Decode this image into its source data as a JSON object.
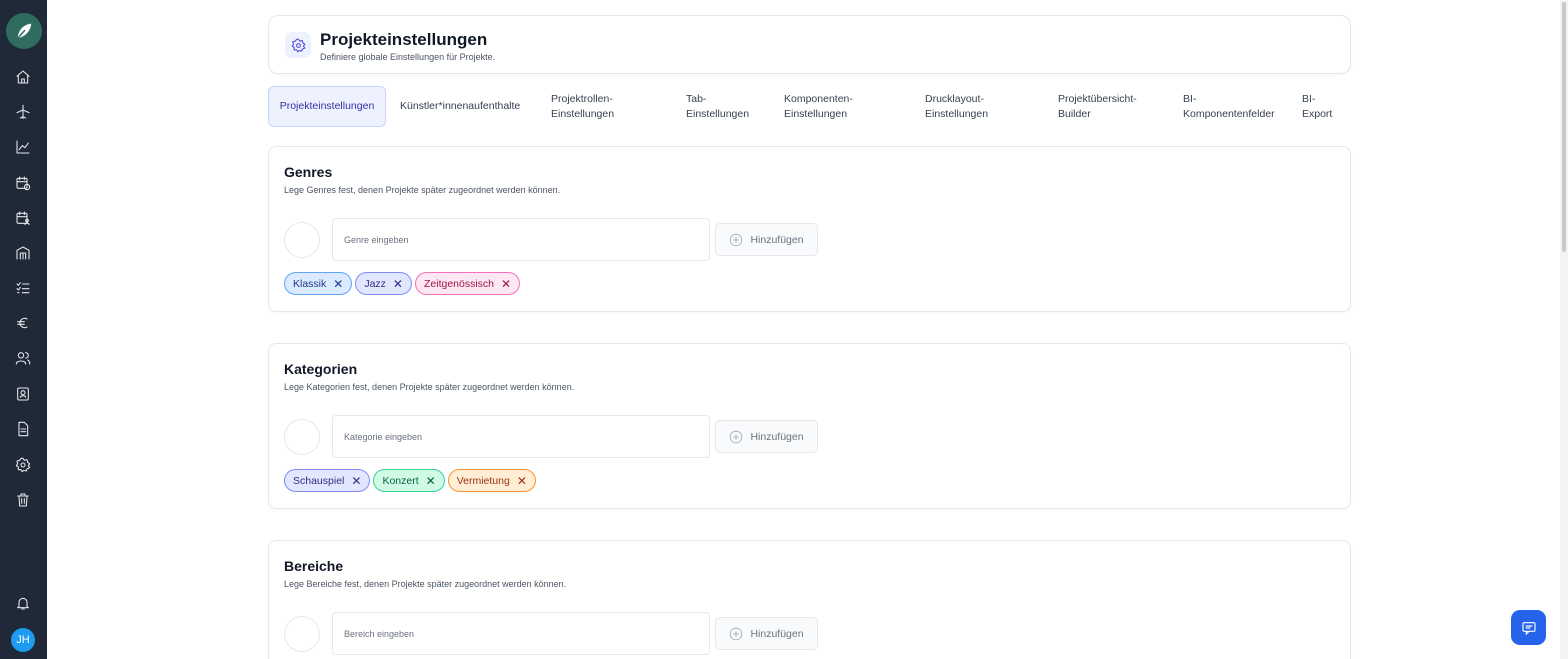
{
  "sidebar": {
    "icons": [
      "home-icon",
      "plane-icon",
      "chart-icon",
      "calendar-clock-icon",
      "calendar-user-icon",
      "building-icon",
      "checklist-icon",
      "euro-icon",
      "users-icon",
      "contacts-icon",
      "document-icon",
      "gear-icon",
      "trash-icon",
      "bell-icon"
    ],
    "avatar_initials": "JH"
  },
  "header": {
    "title": "Projekteinstellungen",
    "subtitle": "Definiere globale Einstellungen für Projekte."
  },
  "tabs": [
    {
      "label": "Projekteinstellungen",
      "active": true
    },
    {
      "label": "Künstler*innenaufenthalte"
    },
    {
      "label": "Projektrollen-Einstellungen"
    },
    {
      "label": "Tab-Einstellungen"
    },
    {
      "label": "Komponenten-Einstellungen"
    },
    {
      "label": "Drucklayout-Einstellungen"
    },
    {
      "label": "Projektübersicht-Builder"
    },
    {
      "label": "BI-Komponentenfelder"
    },
    {
      "label": "BI-Export"
    }
  ],
  "sections": {
    "genres": {
      "title": "Genres",
      "subtitle": "Lege Genres fest, denen Projekte später zugeordnet werden können.",
      "placeholder": "Genre eingeben",
      "add_label": "Hinzufügen",
      "tags": [
        {
          "label": "Klassik",
          "bg": "#dbeafe",
          "border": "#60a5fa",
          "color": "#1e3a8a"
        },
        {
          "label": "Jazz",
          "bg": "#e0e7ff",
          "border": "#818cf8",
          "color": "#312e81"
        },
        {
          "label": "Zeitgenössisch",
          "bg": "#fce7f3",
          "border": "#f472b6",
          "color": "#9d174d"
        }
      ]
    },
    "kategorien": {
      "title": "Kategorien",
      "subtitle": "Lege Kategorien fest, denen Projekte später zugeordnet werden können.",
      "placeholder": "Kategorie eingeben",
      "add_label": "Hinzufügen",
      "tags": [
        {
          "label": "Schauspiel",
          "bg": "#e0e7ff",
          "border": "#818cf8",
          "color": "#312e81"
        },
        {
          "label": "Konzert",
          "bg": "#d1fae5",
          "border": "#34d399",
          "color": "#065f46"
        },
        {
          "label": "Vermietung",
          "bg": "#ffedd5",
          "border": "#fb923c",
          "color": "#9a3412"
        }
      ]
    },
    "bereiche": {
      "title": "Bereiche",
      "subtitle": "Lege Bereiche fest, denen Projekte später zugeordnet werden können.",
      "placeholder": "Bereich eingeben",
      "add_label": "Hinzufügen"
    }
  },
  "chat": {
    "icon": "chat-icon"
  }
}
